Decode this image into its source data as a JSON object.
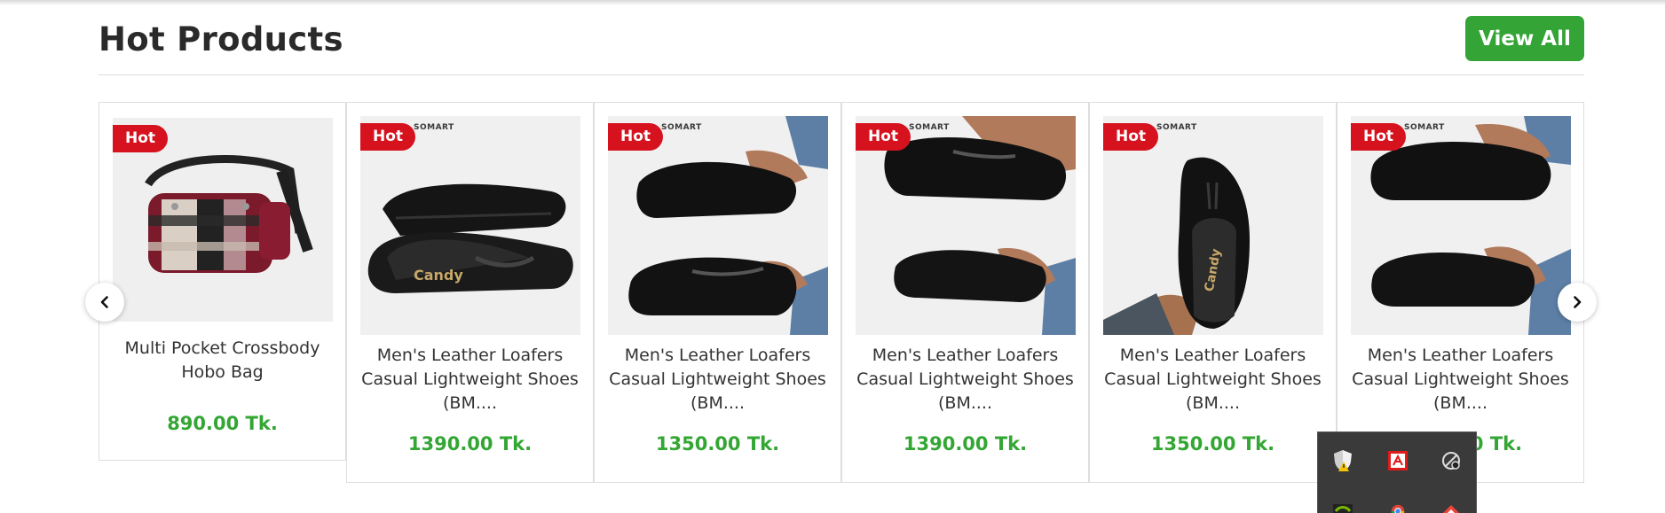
{
  "section": {
    "title": "Hot Products",
    "view_all_label": "View All"
  },
  "badge_label": "Hot",
  "brand_watermark": "SOMART",
  "products": [
    {
      "name": "Multi Pocket Crossbody Hobo Bag",
      "price": "890.00 Tk.",
      "image": "crossbody-bag"
    },
    {
      "name": "Men's Leather Loafers Casual Lightweight Shoes (BM....",
      "price": "1390.00 Tk.",
      "image": "loafer-pair"
    },
    {
      "name": "Men's Leather Loafers Casual Lightweight Shoes (BM....",
      "price": "1350.00 Tk.",
      "image": "loafer-worn"
    },
    {
      "name": "Men's Leather Loafers Casual Lightweight Shoes (BM....",
      "price": "1390.00 Tk.",
      "image": "loafer-worn"
    },
    {
      "name": "Men's Leather Loafers Casual Lightweight Shoes (BM....",
      "price": "1350.00 Tk.",
      "image": "loafer-hand"
    },
    {
      "name": "Men's Leather Loafers Casual Lightweight Shoes (BM....",
      "price": "1350.00 Tk.",
      "image": "loafer-worn"
    }
  ],
  "carousel": {
    "prev_icon": "chevron-left-icon",
    "next_icon": "chevron-right-icon"
  },
  "system_tray": {
    "icons": [
      "security-shield-icon",
      "adobe-acrobat-icon",
      "network-icon",
      "nvidia-icon",
      "chrome-icon",
      "anydesk-icon"
    ]
  },
  "colors": {
    "accent_green": "#34a437",
    "price_green": "#33a634",
    "badge_red": "#d6121f"
  }
}
